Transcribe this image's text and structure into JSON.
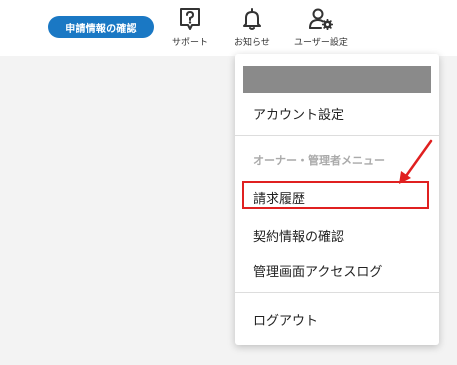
{
  "header": {
    "confirm_button_label": "申請情報の確認",
    "support_label": "サポート",
    "notice_label": "お知らせ",
    "user_settings_label": "ユーザー設定"
  },
  "menu": {
    "account_settings": "アカウント設定",
    "section_label": "オーナー・管理者メニュー",
    "billing_history": "請求履歴",
    "contract_info": "契約情報の確認",
    "admin_access_log": "管理画面アクセスログ",
    "logout": "ログアウト"
  },
  "colors": {
    "accent_blue": "#1a78c4",
    "annotation_red": "#e02020"
  },
  "icons": [
    "help-box-icon",
    "bell-icon",
    "user-gear-icon",
    "arrow-icon"
  ]
}
